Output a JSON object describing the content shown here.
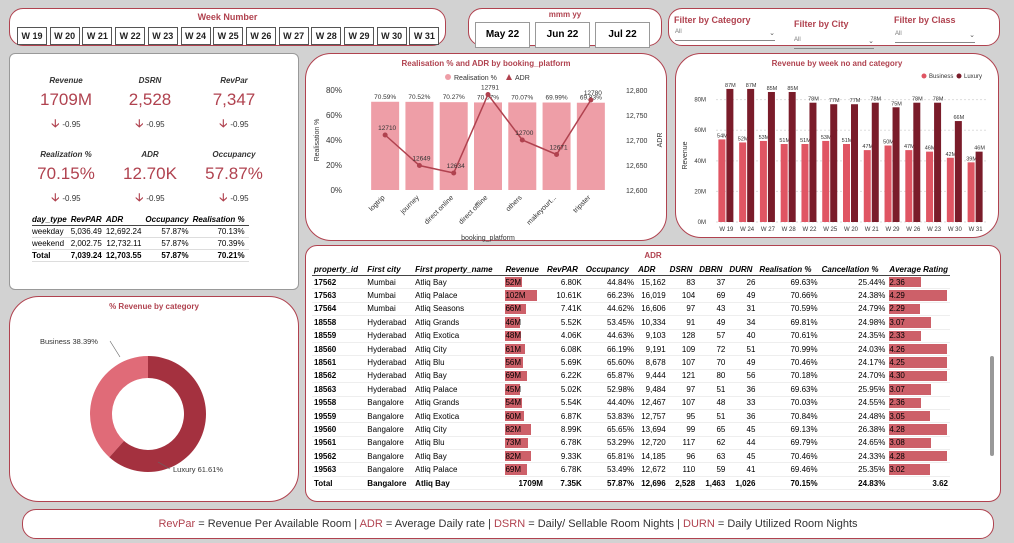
{
  "week_slicer": {
    "title": "Week Number",
    "weeks": [
      "W 19",
      "W 20",
      "W 21",
      "W 22",
      "W 23",
      "W 24",
      "W 25",
      "W 26",
      "W 27",
      "W 28",
      "W 29",
      "W 30",
      "W 31"
    ]
  },
  "month_slicer": {
    "title": "mmm yy",
    "months": [
      "May 22",
      "Jun 22",
      "Jul 22"
    ]
  },
  "filters": [
    {
      "title": "Filter by Category",
      "value": "All"
    },
    {
      "title": "Filter by City",
      "value": "All"
    },
    {
      "title": "Filter by Class",
      "value": "All"
    }
  ],
  "kpis": [
    {
      "label": "Revenue",
      "value": "1709M",
      "delta": "-0.95"
    },
    {
      "label": "DSRN",
      "value": "2,528",
      "delta": "-0.95"
    },
    {
      "label": "RevPar",
      "value": "7,347",
      "delta": "-0.95"
    },
    {
      "label": "Realization %",
      "value": "70.15%",
      "delta": "-0.95"
    },
    {
      "label": "ADR",
      "value": "12.70K",
      "delta": "-0.95"
    },
    {
      "label": "Occupancy",
      "value": "57.87%",
      "delta": "-0.95"
    }
  ],
  "day_type_table": {
    "headers": [
      "day_type",
      "RevPAR",
      "ADR",
      "Occupancy",
      "Realisation %"
    ],
    "rows": [
      [
        "weekday",
        "5,036.49",
        "12,692.24",
        "57.87%",
        "70.13%"
      ],
      [
        "weekend",
        "2,002.75",
        "12,732.11",
        "57.87%",
        "70.39%"
      ],
      [
        "Total",
        "7,039.24",
        "12,703.55",
        "57.87%",
        "70.21%"
      ]
    ]
  },
  "chart_data": [
    {
      "type": "bar",
      "title": "Realisation % and ADR by booking_platform",
      "xlabel": "booking_platform",
      "ylabel": "Realisation %",
      "y2label": "ADR",
      "categories": [
        "logtrip",
        "journey",
        "direct online",
        "direct offline",
        "others",
        "makeyourt...",
        "tripster"
      ],
      "series": [
        {
          "name": "Realisation %",
          "type": "bar",
          "values": [
            70.59,
            70.52,
            70.27,
            70.07,
            70.07,
            69.99,
            69.83
          ],
          "labels": [
            "70.59%",
            "70.52%",
            "70.27%",
            "70.07%",
            "70.07%",
            "69.99%",
            "69.83%"
          ]
        },
        {
          "name": "ADR",
          "type": "line",
          "values": [
            12710,
            12649,
            12634,
            12791,
            12700,
            12671,
            12780
          ],
          "labels": [
            "12710",
            "12649",
            "12634",
            "12791",
            "12700",
            "12671",
            "12780"
          ]
        }
      ],
      "y_ticks": [
        "0%",
        "20%",
        "40%",
        "60%",
        "80%"
      ],
      "y2_ticks": [
        "12,600",
        "12,650",
        "12,700",
        "12,750",
        "12,800"
      ],
      "colors": {
        "bar": "#ee9ea7",
        "line": "#b0424f"
      }
    },
    {
      "type": "bar",
      "title": "Revenue by week no and category",
      "ylabel": "Revenue",
      "categories": [
        "W 19",
        "W 24",
        "W 27",
        "W 28",
        "W 22",
        "W 25",
        "W 20",
        "W 21",
        "W 29",
        "W 26",
        "W 23",
        "W 30",
        "W 31"
      ],
      "series": [
        {
          "name": "Business",
          "values": [
            54,
            52,
            53,
            51,
            51,
            53,
            51,
            47,
            50,
            47,
            46,
            42,
            39
          ],
          "labels": [
            "54M",
            "52M",
            "53M",
            "51M",
            "51M",
            "53M",
            "51M",
            "47M",
            "50M",
            "47M",
            "46M",
            "42M",
            "39M"
          ]
        },
        {
          "name": "Luxury",
          "values": [
            87,
            87,
            85,
            85,
            78,
            77,
            77,
            78,
            75,
            78,
            78,
            66,
            46
          ],
          "labels": [
            "87M",
            "87M",
            "85M",
            "85M",
            "78M",
            "77M",
            "77M",
            "78M",
            "75M",
            "78M",
            "78M",
            "66M",
            "46M"
          ]
        }
      ],
      "y_ticks": [
        "0M",
        "20M",
        "40M",
        "60M",
        "80M"
      ],
      "colors": {
        "Business": "#e05563",
        "Luxury": "#7a1c2a"
      }
    },
    {
      "type": "pie",
      "title": "% Revenue by category",
      "slices": [
        {
          "name": "Business",
          "value": 38.39,
          "label": "Business 38.39%"
        },
        {
          "name": "Luxury",
          "value": 61.61,
          "label": "Luxury 61.61%"
        }
      ],
      "colors": {
        "Business": "#e06b78",
        "Luxury": "#a4313f"
      }
    }
  ],
  "property_table": {
    "title": "ADR",
    "headers": [
      "property_id",
      "First city",
      "First property_name",
      "Revenue",
      "RevPAR",
      "Occupancy",
      "ADR",
      "DSRN",
      "DBRN",
      "DURN",
      "Realisation %",
      "Cancellation %",
      "Average Rating"
    ],
    "rows": [
      [
        "17562",
        "Mumbai",
        "Atliq Bay",
        "52M",
        "6.80K",
        "44.84%",
        "15,162",
        "83",
        "37",
        "26",
        "69.63%",
        "25.44%",
        "2.36"
      ],
      [
        "17563",
        "Mumbai",
        "Atliq Palace",
        "102M",
        "10.61K",
        "66.23%",
        "16,019",
        "104",
        "69",
        "49",
        "70.66%",
        "24.38%",
        "4.29"
      ],
      [
        "17564",
        "Mumbai",
        "Atliq Seasons",
        "66M",
        "7.41K",
        "44.62%",
        "16,606",
        "97",
        "43",
        "31",
        "70.59%",
        "24.79%",
        "2.29"
      ],
      [
        "18558",
        "Hyderabad",
        "Atliq Grands",
        "46M",
        "5.52K",
        "53.45%",
        "10,334",
        "91",
        "49",
        "34",
        "69.81%",
        "24.98%",
        "3.07"
      ],
      [
        "18559",
        "Hyderabad",
        "Atliq Exotica",
        "48M",
        "4.06K",
        "44.63%",
        "9,103",
        "128",
        "57",
        "40",
        "70.61%",
        "24.35%",
        "2.33"
      ],
      [
        "18560",
        "Hyderabad",
        "Atliq City",
        "61M",
        "6.08K",
        "66.19%",
        "9,191",
        "109",
        "72",
        "51",
        "70.99%",
        "24.03%",
        "4.26"
      ],
      [
        "18561",
        "Hyderabad",
        "Atliq Blu",
        "56M",
        "5.69K",
        "65.60%",
        "8,678",
        "107",
        "70",
        "49",
        "70.46%",
        "24.17%",
        "4.25"
      ],
      [
        "18562",
        "Hyderabad",
        "Atliq Bay",
        "69M",
        "6.22K",
        "65.87%",
        "9,444",
        "121",
        "80",
        "56",
        "70.18%",
        "24.70%",
        "4.30"
      ],
      [
        "18563",
        "Hyderabad",
        "Atliq Palace",
        "45M",
        "5.02K",
        "52.98%",
        "9,484",
        "97",
        "51",
        "36",
        "69.63%",
        "25.95%",
        "3.07"
      ],
      [
        "19558",
        "Bangalore",
        "Atliq Grands",
        "54M",
        "5.54K",
        "44.40%",
        "12,467",
        "107",
        "48",
        "33",
        "70.03%",
        "24.55%",
        "2.36"
      ],
      [
        "19559",
        "Bangalore",
        "Atliq Exotica",
        "60M",
        "6.87K",
        "53.83%",
        "12,757",
        "95",
        "51",
        "36",
        "70.84%",
        "24.48%",
        "3.05"
      ],
      [
        "19560",
        "Bangalore",
        "Atliq City",
        "82M",
        "8.99K",
        "65.65%",
        "13,694",
        "99",
        "65",
        "45",
        "69.13%",
        "26.38%",
        "4.28"
      ],
      [
        "19561",
        "Bangalore",
        "Atliq Blu",
        "73M",
        "6.78K",
        "53.29%",
        "12,720",
        "117",
        "62",
        "44",
        "69.79%",
        "24.65%",
        "3.08"
      ],
      [
        "19562",
        "Bangalore",
        "Atliq Bay",
        "82M",
        "9.33K",
        "65.81%",
        "14,185",
        "96",
        "63",
        "45",
        "70.46%",
        "24.33%",
        "4.28"
      ],
      [
        "19563",
        "Bangalore",
        "Atliq Palace",
        "69M",
        "6.78K",
        "53.49%",
        "12,672",
        "110",
        "59",
        "41",
        "69.46%",
        "25.35%",
        "3.02"
      ]
    ],
    "total": [
      "Total",
      "Bangalore",
      "Atliq Bay",
      "1709M",
      "7.35K",
      "57.87%",
      "12,696",
      "2,528",
      "1,463",
      "1,026",
      "70.15%",
      "24.83%",
      "3.62"
    ],
    "revenue_values": [
      52,
      102,
      66,
      46,
      48,
      61,
      56,
      69,
      45,
      54,
      60,
      82,
      73,
      82,
      69
    ],
    "rating_values": [
      2.36,
      4.29,
      2.29,
      3.07,
      2.33,
      4.26,
      4.25,
      4.3,
      3.07,
      2.36,
      3.05,
      4.28,
      3.08,
      4.28,
      3.02
    ]
  },
  "footer": {
    "k1": "RevPar",
    "d1": " = Revenue Per Available Room | ",
    "k2": "ADR",
    "d2": " = Average Daily rate | ",
    "k3": "DSRN",
    "d3": " = Daily/ Sellable Room Nights | ",
    "k4": "DURN",
    "d4": " = Daily Utilized Room Nights"
  }
}
